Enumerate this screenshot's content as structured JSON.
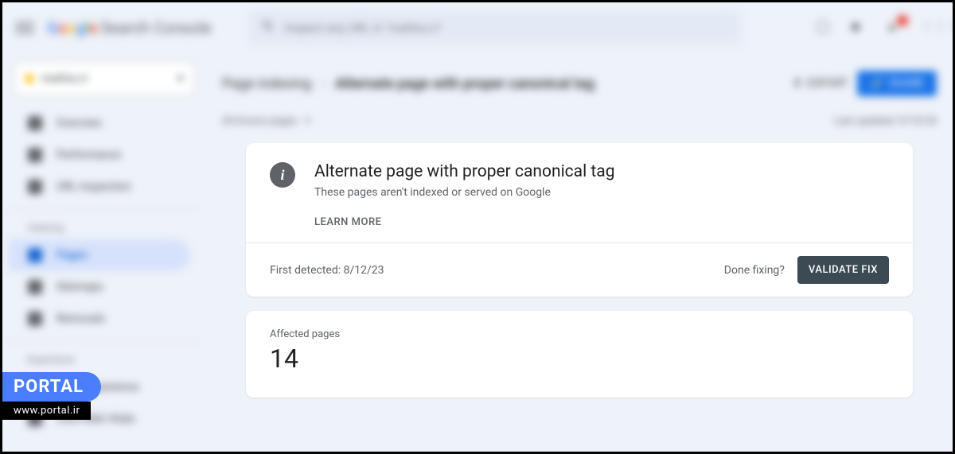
{
  "header": {
    "product_name": "Search Console",
    "search_placeholder": "Inspect any URL in \"mahlou.ir\""
  },
  "sidebar": {
    "property": "mahlou.ir",
    "items_top": [
      {
        "label": "Overview"
      },
      {
        "label": "Performance"
      },
      {
        "label": "URL inspection"
      }
    ],
    "section_indexing": "Indexing",
    "items_indexing": [
      {
        "label": "Pages"
      },
      {
        "label": "Sitemaps"
      },
      {
        "label": "Removals"
      }
    ],
    "section_experience": "Experience",
    "items_experience": [
      {
        "label": "Page Experience"
      },
      {
        "label": "Core Web Vitals"
      }
    ]
  },
  "breadcrumb": {
    "parent": "Page indexing",
    "current": "Alternate page with proper canonical tag",
    "export": "EXPORT",
    "share": "SHARE"
  },
  "filter": {
    "label": "All known pages",
    "last_updated": "Last updated: 9/10/24"
  },
  "issue_card": {
    "title": "Alternate page with proper canonical tag",
    "subtitle": "These pages aren't indexed or served on Google",
    "learn_more": "LEARN MORE",
    "first_detected_label": "First detected: ",
    "first_detected_date": "8/12/23",
    "done_fixing": "Done fixing?",
    "validate": "VALIDATE FIX"
  },
  "affected": {
    "label": "Affected pages",
    "count": "14"
  },
  "watermark": {
    "brand": "PORTAL",
    "url": "www.portal.ir"
  }
}
